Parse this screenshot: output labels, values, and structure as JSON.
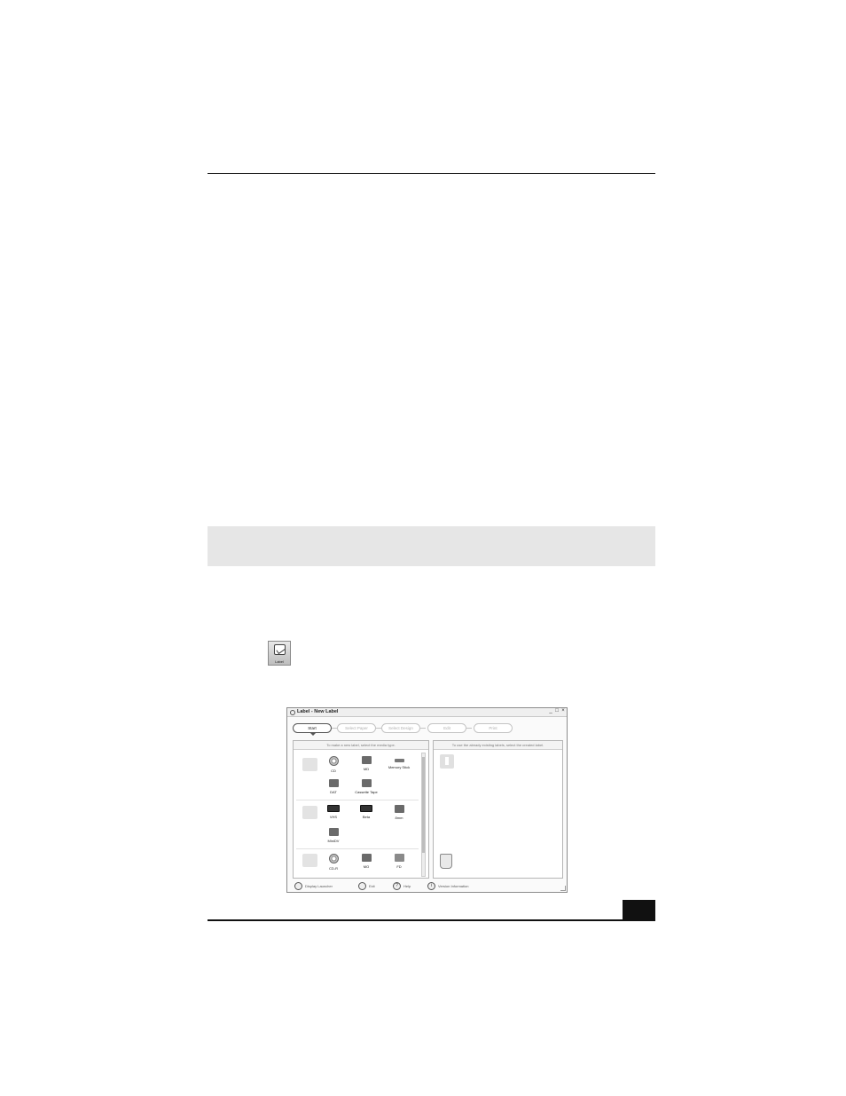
{
  "launcher": {
    "icon": "label-icon",
    "caption": "Label"
  },
  "window": {
    "title": "Label - New Label",
    "controls": [
      "_",
      "□",
      "×"
    ],
    "steps": [
      "Start",
      "Select Paper",
      "Select Design",
      "Edit",
      "Print"
    ],
    "left_panel": {
      "header": "To make a new label, select the media type.",
      "groups": [
        {
          "items": [
            "CD",
            "MD",
            "Memory Stick",
            "DAT",
            "Cassette Tape"
          ]
        },
        {
          "items": [
            "VHS",
            "Beta",
            "8mm",
            "MiniDV"
          ]
        },
        {
          "items": [
            "CD-R",
            "MO",
            "FD"
          ]
        }
      ]
    },
    "right_panel": {
      "header": "To use the already existing labels, select the created label."
    },
    "footer": [
      "Display Launcher",
      "Exit",
      "Help",
      "Version Information"
    ]
  }
}
